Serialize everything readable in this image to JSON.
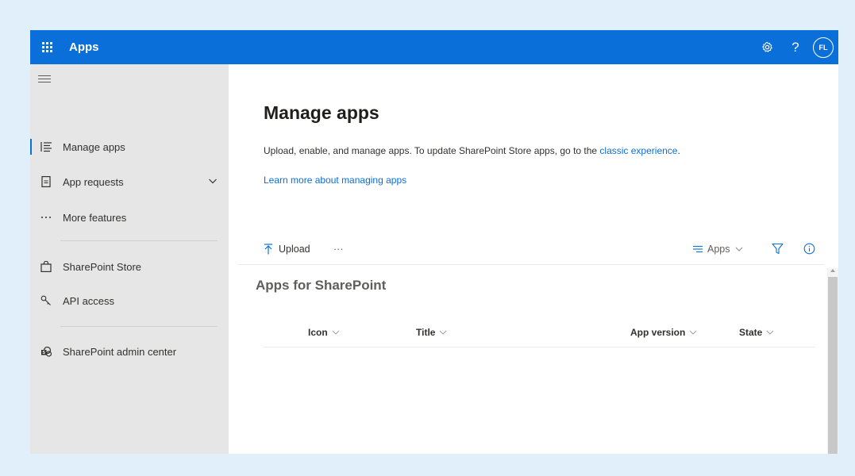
{
  "topbar": {
    "app_title": "Apps",
    "help_label": "?",
    "avatar_initials": "FL",
    "brand_color": "#0a6fd8"
  },
  "sidebar": {
    "items": [
      {
        "label": "Manage apps",
        "icon": "list-icon",
        "active": true
      },
      {
        "label": "App requests",
        "icon": "document-icon",
        "has_chevron": true
      },
      {
        "label": "More features",
        "icon": "ellipsis-icon"
      },
      {
        "label": "SharePoint Store",
        "icon": "shopping-bag-icon"
      },
      {
        "label": "API access",
        "icon": "key-icon"
      },
      {
        "label": "SharePoint admin center",
        "icon": "sharepoint-icon"
      }
    ]
  },
  "main": {
    "title": "Manage apps",
    "description_prefix": "Upload, enable, and manage apps. To update SharePoint Store apps, go to the ",
    "description_link": "classic experience",
    "description_suffix": ".",
    "learn_more": "Learn more about managing apps",
    "commands": {
      "upload": "Upload",
      "more": "···",
      "view": "Apps"
    },
    "section_title": "Apps for SharePoint",
    "columns": [
      "Icon",
      "Title",
      "App version",
      "State"
    ]
  }
}
